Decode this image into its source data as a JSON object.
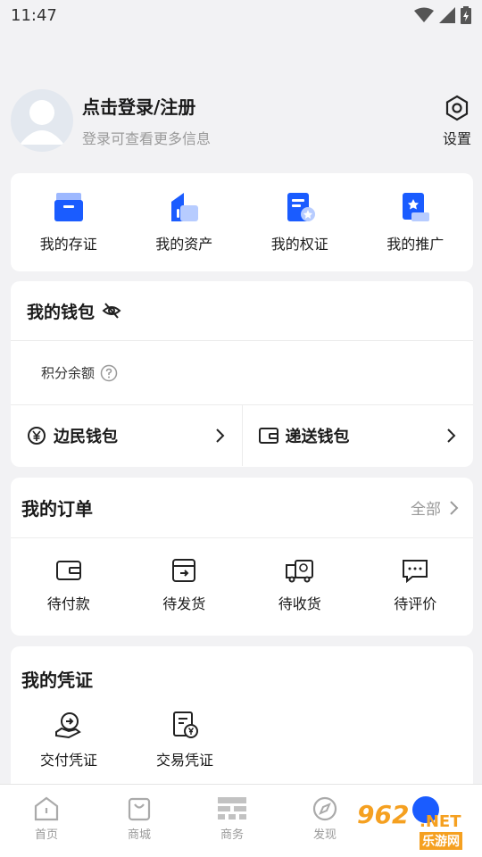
{
  "status_bar": {
    "time": "11:47"
  },
  "profile": {
    "title": "点击登录/注册",
    "subtitle": "登录可查看更多信息",
    "settings_label": "设置"
  },
  "quick_links": [
    {
      "label": "我的存证",
      "icon": "certificate-box-icon"
    },
    {
      "label": "我的资产",
      "icon": "asset-chart-icon"
    },
    {
      "label": "我的权证",
      "icon": "rights-doc-icon"
    },
    {
      "label": "我的推广",
      "icon": "promotion-star-icon"
    }
  ],
  "wallet": {
    "title": "我的钱包",
    "points_label": "积分余额",
    "items": [
      {
        "label": "边民钱包",
        "icon": "yuan-circle-icon"
      },
      {
        "label": "递送钱包",
        "icon": "wallet-icon"
      }
    ]
  },
  "orders": {
    "title": "我的订单",
    "all_label": "全部",
    "items": [
      {
        "label": "待付款",
        "icon": "wallet-icon"
      },
      {
        "label": "待发货",
        "icon": "ship-box-icon"
      },
      {
        "label": "待收货",
        "icon": "truck-icon"
      },
      {
        "label": "待评价",
        "icon": "comment-icon"
      }
    ]
  },
  "vouchers": {
    "title": "我的凭证",
    "items": [
      {
        "label": "交付凭证",
        "icon": "hand-deliver-icon"
      },
      {
        "label": "交易凭证",
        "icon": "receipt-yuan-icon"
      }
    ]
  },
  "tabbar": [
    {
      "label": "首页",
      "icon": "home-icon"
    },
    {
      "label": "商城",
      "icon": "shopping-bag-icon"
    },
    {
      "label": "商务",
      "icon": "business-icon"
    },
    {
      "label": "发现",
      "icon": "compass-icon"
    }
  ],
  "watermark": {
    "number": "962",
    "net": ".NET",
    "site": "乐游网"
  },
  "colors": {
    "accent": "#1a5cff",
    "background": "#f2f2f4",
    "card": "#ffffff",
    "watermark": "#f5a020"
  }
}
